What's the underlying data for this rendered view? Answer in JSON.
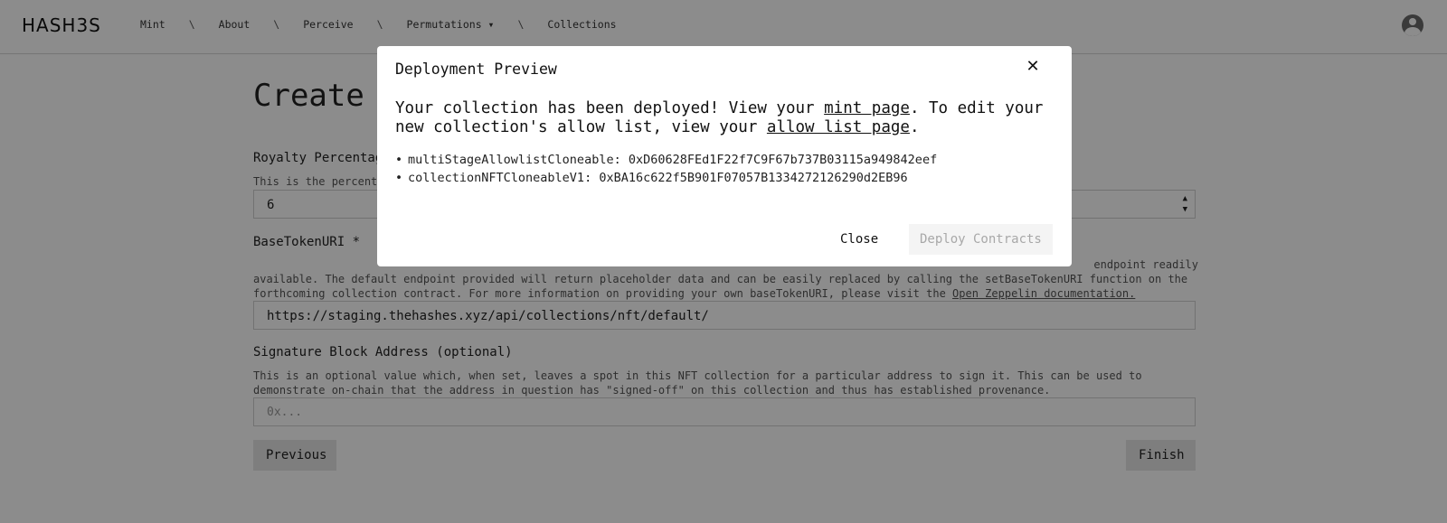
{
  "nav": {
    "logo": "HASH3S",
    "links": [
      "Mint",
      "About",
      "Perceive",
      "Permutations ▾",
      "Collections"
    ],
    "separator": "\\"
  },
  "page": {
    "title_visible": "Create a",
    "royalty": {
      "label": "Royalty Percentage",
      "help_visible": "This is the percent",
      "value": "6"
    },
    "base_token_uri": {
      "label": "BaseTokenURI",
      "required_mark": "*",
      "help_line1_end": "endpoint readily",
      "help_line2": "available. The default endpoint provided will return placeholder data and can be easily replaced by calling the setBaseTokenURI function on the",
      "help_line3": "forthcoming collection contract. For more information on providing your own baseTokenURI, please visit the ",
      "help_link": "Open Zeppelin documentation.",
      "value": "https://staging.thehashes.xyz/api/collections/nft/default/"
    },
    "signature": {
      "label": "Signature Block Address (optional)",
      "help": "This is an optional value which, when set, leaves a spot in this NFT collection for a particular address to sign it. This can be used to demonstrate on-chain that the address in question has \"signed-off\" on this collection and thus has established provenance.",
      "placeholder": "0x..."
    },
    "previous_label": "Previous",
    "finish_label": "Finish"
  },
  "modal": {
    "title": "Deployment Preview",
    "message_part1": "Your collection has been deployed! View your ",
    "mint_link": "mint page",
    "message_part2": ". To edit your new collection's allow list, view your ",
    "allow_link": "allow list page",
    "message_part3": ".",
    "contracts": [
      "multiStageAllowlistCloneable: 0xD60628FEd1F22f7C9F67b737B03115a949842eef",
      "collectionNFTCloneableV1: 0xBA16c622f5B901F07057B1334272126290d2EB96"
    ],
    "close_label": "Close",
    "deploy_label": "Deploy Contracts"
  }
}
